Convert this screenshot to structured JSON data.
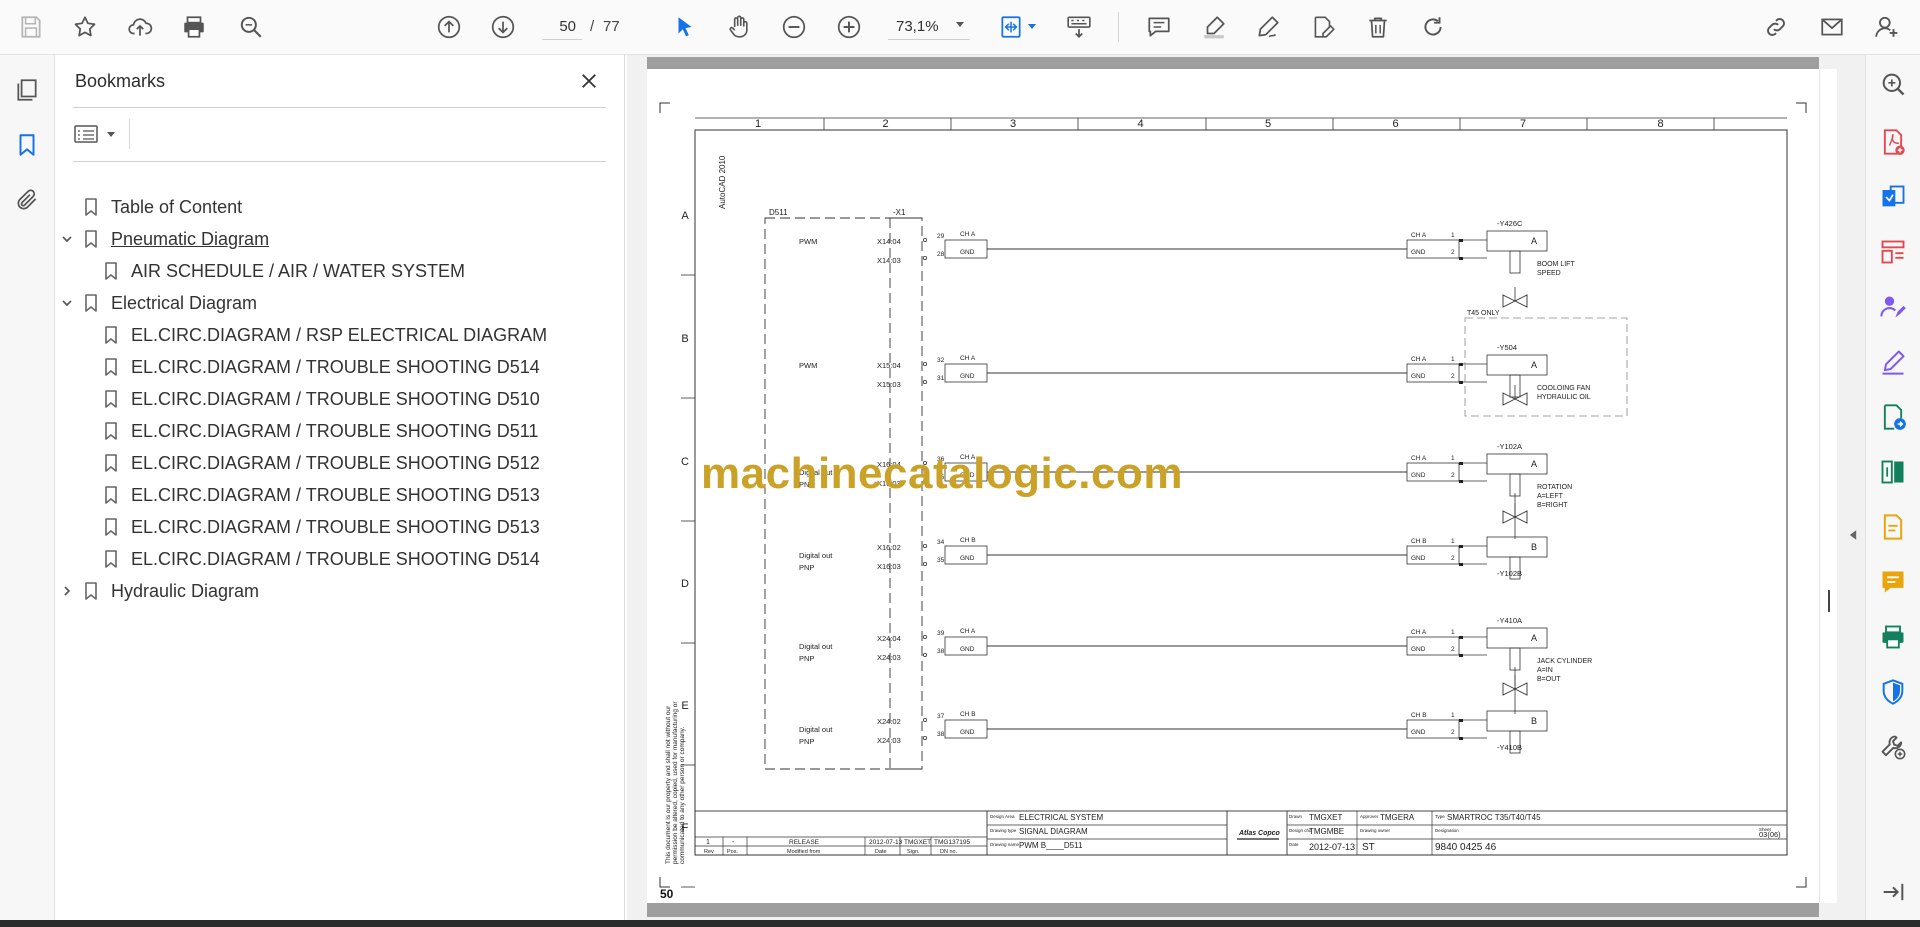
{
  "toolbar": {
    "current_page": "50",
    "page_separator": "/",
    "total_pages": "77",
    "zoom": "73,1%"
  },
  "bookmarks_panel": {
    "title": "Bookmarks",
    "items": [
      {
        "label": "Table of Content",
        "level": 0,
        "expander": "none",
        "underline": false
      },
      {
        "label": "Pneumatic Diagram",
        "level": 0,
        "expander": "expanded",
        "underline": true
      },
      {
        "label": "AIR SCHEDULE / AIR / WATER SYSTEM",
        "level": 1,
        "expander": "none",
        "underline": false
      },
      {
        "label": "Electrical Diagram",
        "level": 0,
        "expander": "expanded",
        "underline": false
      },
      {
        "label": "EL.CIRC.DIAGRAM / RSP ELECTRICAL DIAGRAM",
        "level": 1,
        "expander": "none",
        "underline": false
      },
      {
        "label": "EL.CIRC.DIAGRAM / TROUBLE SHOOTING D514",
        "level": 1,
        "expander": "none",
        "underline": false
      },
      {
        "label": "EL.CIRC.DIAGRAM / TROUBLE SHOOTING D510",
        "level": 1,
        "expander": "none",
        "underline": false
      },
      {
        "label": "EL.CIRC.DIAGRAM / TROUBLE SHOOTING D511",
        "level": 1,
        "expander": "none",
        "underline": false
      },
      {
        "label": "EL.CIRC.DIAGRAM / TROUBLE SHOOTING D512",
        "level": 1,
        "expander": "none",
        "underline": false
      },
      {
        "label": "EL.CIRC.DIAGRAM / TROUBLE SHOOTING D513",
        "level": 1,
        "expander": "none",
        "underline": false
      },
      {
        "label": "EL.CIRC.DIAGRAM / TROUBLE SHOOTING D513",
        "level": 1,
        "expander": "none",
        "underline": false
      },
      {
        "label": "EL.CIRC.DIAGRAM / TROUBLE SHOOTING D514",
        "level": 1,
        "expander": "none",
        "underline": false
      },
      {
        "label": "Hydraulic Diagram",
        "level": 0,
        "expander": "collapsed",
        "underline": false
      }
    ]
  },
  "document": {
    "page_number": "50",
    "watermark": "machinecatalogic.com",
    "vertical_note": "AutoCAD 2010",
    "copyright_note": [
      "This document is our property and shall not without our",
      "permission be altered, copied, used for manufacturing or",
      "communicated to any other person or company."
    ],
    "column_numbers": [
      "1",
      "2",
      "3",
      "4",
      "5",
      "6",
      "7",
      "8"
    ],
    "row_letters": [
      "A",
      "B",
      "C",
      "D",
      "E",
      "F"
    ],
    "controller": {
      "name": "D511",
      "connector": "-X1"
    },
    "circuits": [
      {
        "signal": "PWM",
        "pins": [
          "X14:04",
          "X14:03"
        ],
        "terminals": [
          "29",
          "28"
        ],
        "wires": [
          "CH A",
          "GND"
        ],
        "valve_pins": [
          "CH A",
          "GND"
        ],
        "valve_nums": [
          "1",
          "2"
        ],
        "valve_id": "-Y426C",
        "valve_port": "A",
        "function": [
          "BOOM LIFT",
          "SPEED"
        ]
      },
      {
        "signal": "PWM",
        "pins": [
          "X15:04",
          "X15:03"
        ],
        "terminals": [
          "32",
          "31"
        ],
        "wires": [
          "CH A",
          "GND"
        ],
        "valve_pins": [
          "CH A",
          "GND"
        ],
        "valve_nums": [
          "1",
          "2"
        ],
        "valve_id": "-Y504",
        "valve_port": "A",
        "function": [
          "COOLOING FAN",
          "HYDRAULIC OIL"
        ],
        "option": "T45 ONLY"
      },
      {
        "signal": "Digital out PNP",
        "pins": [
          "X16:04",
          "X16:03"
        ],
        "terminals": [
          "36",
          "35"
        ],
        "wires": [
          "CH A",
          "GND"
        ],
        "valve_pins": [
          "CH A",
          "GND"
        ],
        "valve_nums": [
          "1",
          "2"
        ],
        "valve_id": "-Y102A",
        "valve_port": "A",
        "function": [
          "ROTATION",
          "A=LEFT",
          "B=RIGHT"
        ]
      },
      {
        "signal": "Digital out PNP",
        "pins": [
          "X16:02",
          "X16:03"
        ],
        "terminals": [
          "34",
          "35"
        ],
        "wires": [
          "CH B",
          "GND"
        ],
        "valve_pins": [
          "CH B",
          "GND"
        ],
        "valve_nums": [
          "1",
          "2"
        ],
        "valve_id": "-Y102B",
        "valve_port": "B",
        "function": []
      },
      {
        "signal": "Digital out PNP",
        "pins": [
          "X24:04",
          "X24:03"
        ],
        "terminals": [
          "39",
          "38"
        ],
        "wires": [
          "CH A",
          "GND"
        ],
        "valve_pins": [
          "CH A",
          "GND"
        ],
        "valve_nums": [
          "1",
          "2"
        ],
        "valve_id": "-Y410A",
        "valve_port": "A",
        "function": [
          "JACK CYLINDER",
          "A=IN",
          "B=OUT"
        ]
      },
      {
        "signal": "Digital out PNP",
        "pins": [
          "X24:02",
          "X24:03"
        ],
        "terminals": [
          "37",
          "38"
        ],
        "wires": [
          "CH B",
          "GND"
        ],
        "valve_pins": [
          "CH B",
          "GND"
        ],
        "valve_nums": [
          "1",
          "2"
        ],
        "valve_id": "-Y410B",
        "valve_port": "B",
        "function": []
      }
    ],
    "title_block": {
      "rev": "1",
      "pos": "-",
      "release": "RELEASE",
      "date": "2012-07-13",
      "sign": "TMGXET",
      "dn_no": "TMG137195",
      "hdr_rev": "Rev",
      "hdr_pos": "Pos.",
      "hdr_modified": "Modified from",
      "hdr_date": "Date",
      "hdr_sign": "Sign.",
      "hdr_dn": "DN no.",
      "design_area_label": "Design Area",
      "design_area": "ELECTRICAL SYSTEM",
      "drawing_type_label": "Drawing type",
      "drawing_type": "SIGNAL DIAGRAM",
      "drawing_name_label": "Drawing name",
      "drawing_name": "PWM B____D511",
      "brand": "Atlas Copco",
      "drawn_label": "Drawn",
      "drawn": "TMGXET",
      "approver_label": "Approver",
      "approver": "TMGERA",
      "design_chd_label": "Design chd",
      "design_chd": "TMGMBE",
      "drawing_owner_label": "Drawing owner",
      "date_label": "Date",
      "date2": "2012-07-13",
      "owner": "ST",
      "type_label": "Type",
      "type": "SMARTROC T35/T40/T45",
      "designation_label": "Designation",
      "designation": "9840 0425 46",
      "sheet_label": "Sheet",
      "sheet": "03(06)"
    }
  },
  "colors": {
    "accent_blue": "#1473e6",
    "watermark": "#c9a227",
    "icon_red": "#e34850",
    "icon_purple": "#7f5af0",
    "icon_teal": "#12805c",
    "icon_yellow": "#e9a50b"
  }
}
